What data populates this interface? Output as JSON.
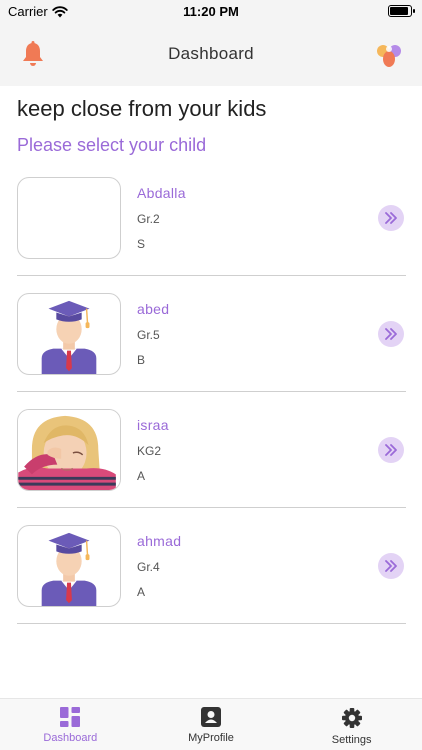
{
  "status_bar": {
    "carrier": "Carrier",
    "time": "11:20 PM"
  },
  "nav": {
    "title": "Dashboard",
    "left_icon": "bell-icon",
    "right_icon": "app-logo-icon"
  },
  "heading": "keep close from your kids",
  "subheading": "Please select your child",
  "children": [
    {
      "name": "Abdalla",
      "grade": "Gr.2",
      "section": "S",
      "avatar": "blank"
    },
    {
      "name": "abed",
      "grade": "Gr.5",
      "section": "B",
      "avatar": "graduate"
    },
    {
      "name": "israa",
      "grade": "KG2",
      "section": "A",
      "avatar": "girl-photo"
    },
    {
      "name": "ahmad",
      "grade": "Gr.4",
      "section": "A",
      "avatar": "graduate"
    }
  ],
  "tabs": [
    {
      "label": "Dashboard",
      "icon": "dashboard-icon",
      "active": true
    },
    {
      "label": "MyProfile",
      "icon": "profile-icon",
      "active": false
    },
    {
      "label": "Settings",
      "icon": "gear-icon",
      "active": false
    }
  ],
  "colors": {
    "accent": "#9a6ad8",
    "bell": "#f07a55",
    "chevron_bg": "#e3d3f5"
  }
}
